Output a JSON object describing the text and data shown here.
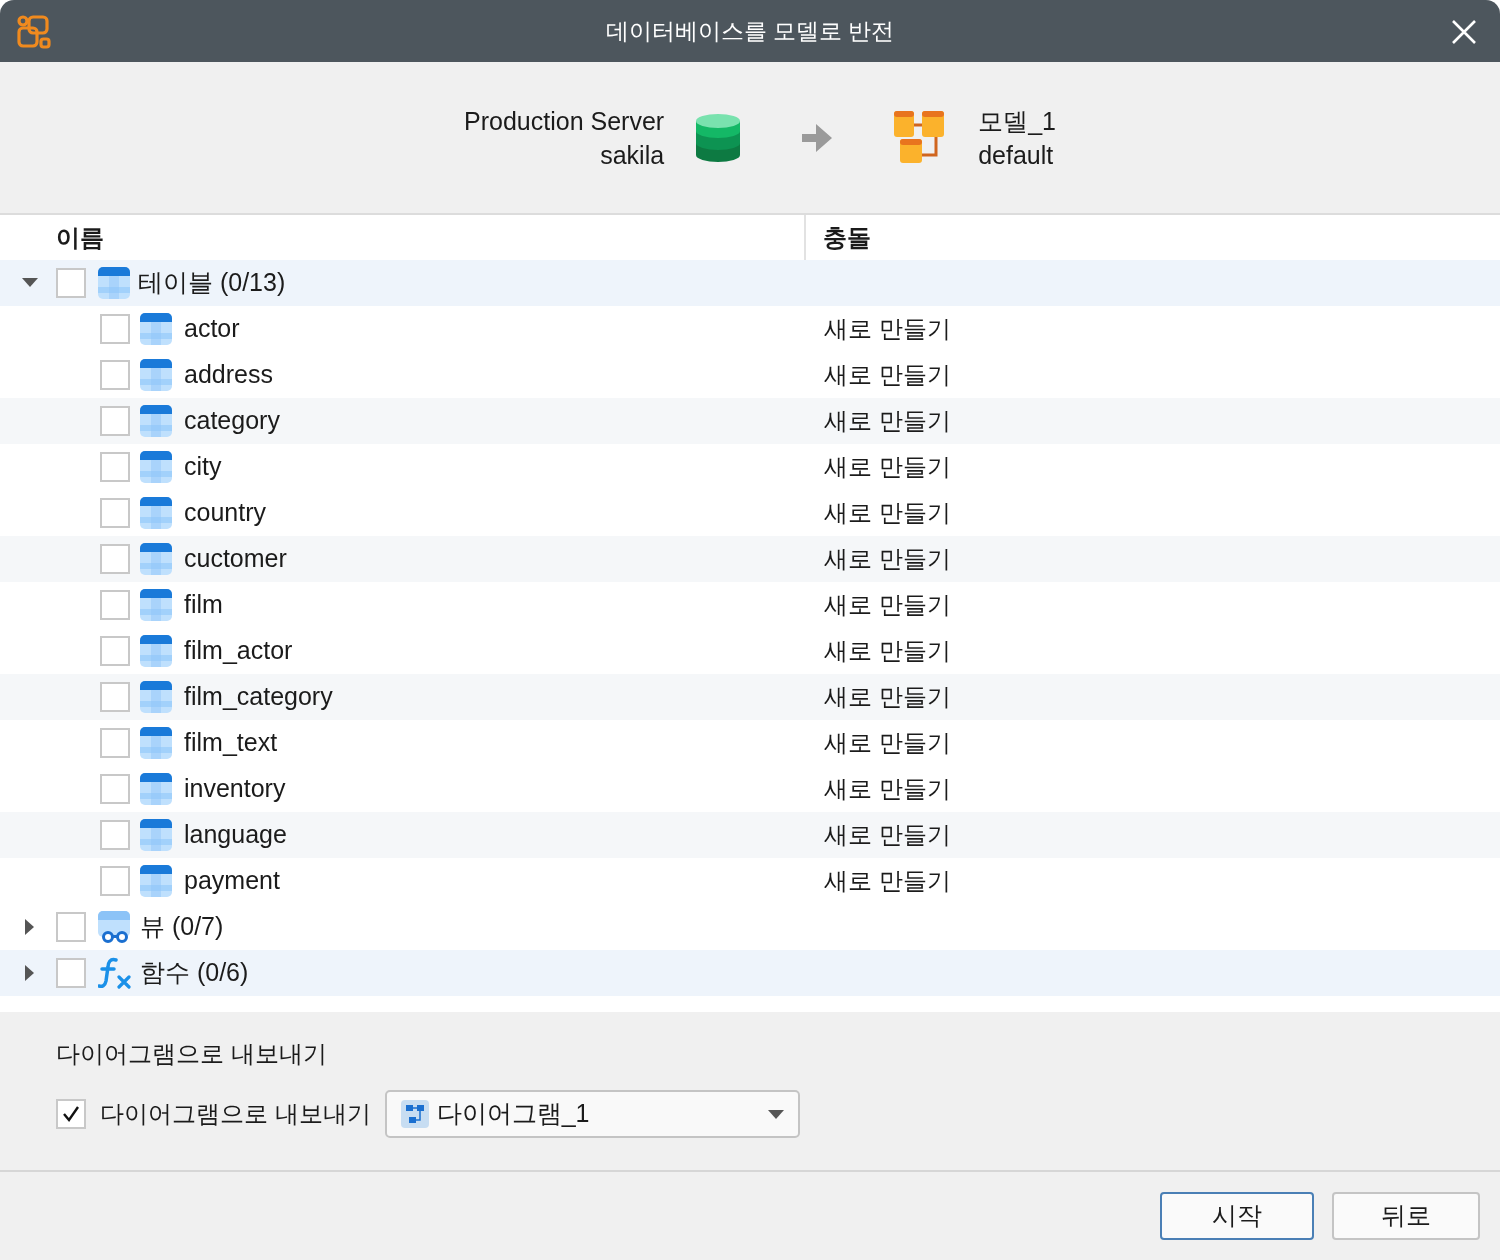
{
  "window": {
    "title": "데이터베이스를 모델로 반전"
  },
  "source": {
    "server": "Production Server",
    "database": "sakila"
  },
  "target": {
    "model": "모델_1",
    "schema": "default"
  },
  "table": {
    "columns": [
      "이름",
      "충돌"
    ],
    "groups": [
      {
        "kind": "table",
        "label": "테이블 (0/13)",
        "expanded": true,
        "checked": false,
        "highlighted": true,
        "children": [
          {
            "name": "actor",
            "conflict": "새로 만들기",
            "checked": false,
            "highlighted": false
          },
          {
            "name": "address",
            "conflict": "새로 만들기",
            "checked": false,
            "highlighted": false
          },
          {
            "name": "category",
            "conflict": "새로 만들기",
            "checked": false,
            "highlighted": true
          },
          {
            "name": "city",
            "conflict": "새로 만들기",
            "checked": false,
            "highlighted": false
          },
          {
            "name": "country",
            "conflict": "새로 만들기",
            "checked": false,
            "highlighted": false
          },
          {
            "name": "cuctomer",
            "conflict": "새로 만들기",
            "checked": false,
            "highlighted": true
          },
          {
            "name": "film",
            "conflict": "새로 만들기",
            "checked": false,
            "highlighted": false
          },
          {
            "name": "film_actor",
            "conflict": "새로 만들기",
            "checked": false,
            "highlighted": false
          },
          {
            "name": "film_category",
            "conflict": "새로 만들기",
            "checked": false,
            "highlighted": true
          },
          {
            "name": "film_text",
            "conflict": "새로 만들기",
            "checked": false,
            "highlighted": false
          },
          {
            "name": "inventory",
            "conflict": "새로 만들기",
            "checked": false,
            "highlighted": false
          },
          {
            "name": "language",
            "conflict": "새로 만들기",
            "checked": false,
            "highlighted": true
          },
          {
            "name": "payment",
            "conflict": "새로 만들기",
            "checked": false,
            "highlighted": false
          }
        ]
      },
      {
        "kind": "view",
        "label": "뷰 (0/7)",
        "expanded": false,
        "checked": false,
        "highlighted": false
      },
      {
        "kind": "function",
        "label": "함수 (0/6)",
        "expanded": false,
        "checked": false,
        "highlighted": true
      }
    ]
  },
  "export": {
    "heading": "다이어그램으로 내보내기",
    "checkbox_label": "다이어그램으로 내보내기",
    "checked": true,
    "diagram": "다이어그램_1"
  },
  "buttons": [
    "시작",
    "뒤로"
  ]
}
